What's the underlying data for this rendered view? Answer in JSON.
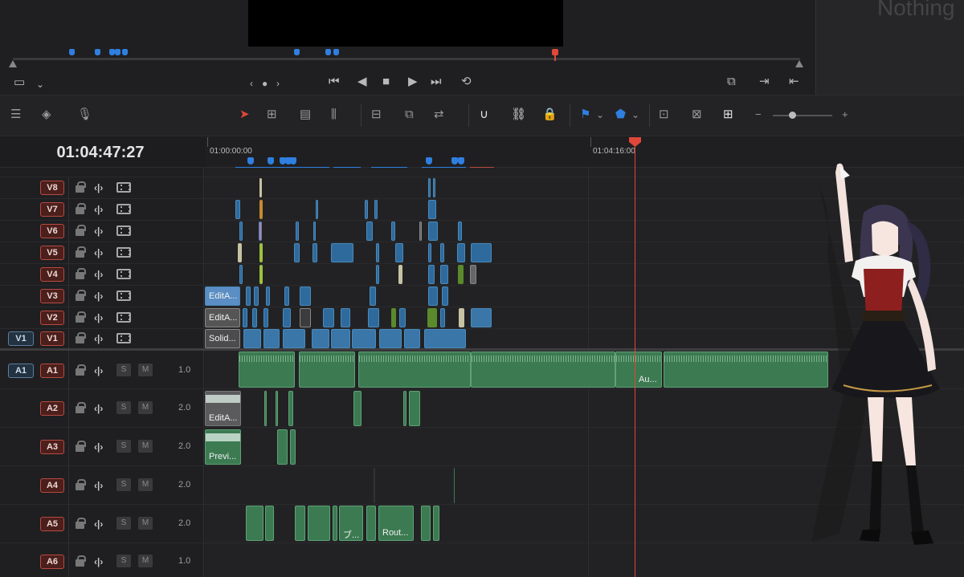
{
  "viewer": {
    "right_panel_text": "Nothing",
    "transport_icons": [
      "jog-prev-icon",
      "stop-icon",
      "play-icon",
      "jog-next-icon",
      "loop-icon"
    ]
  },
  "timecode": "01:04:47:27",
  "ruler": {
    "start_label": "01:00:00:00",
    "mid_label": "01:04:16:00"
  },
  "video_tracks": [
    {
      "label": "V8"
    },
    {
      "label": "V7"
    },
    {
      "label": "V6"
    },
    {
      "label": "V5"
    },
    {
      "label": "V4"
    },
    {
      "label": "V3"
    },
    {
      "label": "V2"
    },
    {
      "label": "V1",
      "source": "V1"
    }
  ],
  "audio_tracks": [
    {
      "label": "A1",
      "source": "A1",
      "solo": "S",
      "mute": "M",
      "volume": "1.0"
    },
    {
      "label": "A2",
      "solo": "S",
      "mute": "M",
      "volume": "2.0"
    },
    {
      "label": "A3",
      "solo": "S",
      "mute": "M",
      "volume": "2.0"
    },
    {
      "label": "A4",
      "solo": "S",
      "mute": "M",
      "volume": "2.0"
    },
    {
      "label": "A5",
      "solo": "S",
      "mute": "M",
      "volume": "2.0"
    },
    {
      "label": "A6",
      "solo": "S",
      "mute": "M",
      "volume": "1.0"
    }
  ],
  "clips": {
    "v3_first": "EditA...",
    "v2_first": "EditA...",
    "v1_first": "Solid...",
    "a1_label": "Au...",
    "a2_label": "EditA...",
    "a3_label": "Previ...",
    "a5_label1": "ブ...",
    "a5_label2": "Rout..."
  },
  "zoom": {
    "minus": "−",
    "plus": "+"
  },
  "colors": {
    "playhead": "#e0473a",
    "marker": "#2f7fe0",
    "video_clip": "#2f6a9c",
    "audio_clip": "#3c7a52"
  }
}
